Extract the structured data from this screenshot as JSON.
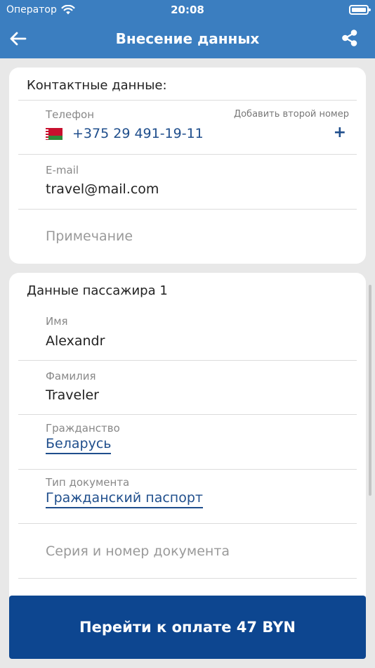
{
  "status_bar": {
    "carrier": "Оператор",
    "time": "20:08"
  },
  "nav": {
    "title": "Внесение данных"
  },
  "contact": {
    "header": "Контактные данные:",
    "phone_label": "Телефон",
    "second_number_label": "Добавить второй номер",
    "phone_value": "+375 29 491-19-11",
    "add_symbol": "+",
    "email_label": "E-mail",
    "email_value": "travel@mail.com",
    "note_placeholder": "Примечание"
  },
  "passenger": {
    "header": "Данные пассажира 1",
    "first_name_label": "Имя",
    "first_name_value": "Alexandr",
    "last_name_label": "Фамилия",
    "last_name_value": "Traveler",
    "citizenship_label": "Гражданство",
    "citizenship_value": "Беларусь",
    "doc_type_label": "Тип документа",
    "doc_type_value": "Гражданский паспорт",
    "doc_number_placeholder": "Серия и номер документа"
  },
  "footer": {
    "pay_button": "Перейти к оплате 47 BYN"
  },
  "colors": {
    "nav_bg": "#3b7ec0",
    "accent": "#1f4e8c",
    "button_bg": "#0d4690"
  },
  "icons": [
    "back-arrow-icon",
    "share-icon",
    "wifi-icon",
    "battery-icon",
    "belarus-flag-icon",
    "plus-icon"
  ]
}
